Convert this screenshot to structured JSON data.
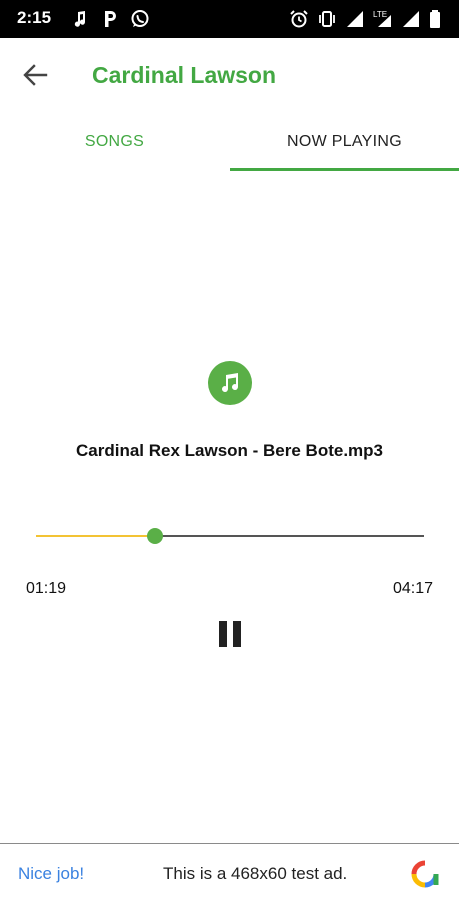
{
  "status_bar": {
    "time": "2:15",
    "left_icons": [
      "music-note-icon",
      "p-icon",
      "whatsapp-icon"
    ],
    "right_icons": [
      "alarm-icon",
      "vibrate-icon",
      "signal-icon",
      "lte-icon",
      "signal-icon",
      "battery-icon"
    ],
    "network": "LTE"
  },
  "app_bar": {
    "title": "Cardinal Lawson",
    "accent_color": "#43a843"
  },
  "tabs": [
    {
      "label": "SONGS",
      "selected": false
    },
    {
      "label": "NOW PLAYING",
      "selected": true
    }
  ],
  "player": {
    "track_title": "Cardinal Rex Lawson - Bere Bote.mp3",
    "elapsed": "01:19",
    "total": "04:17",
    "progress": 0.307,
    "state": "playing",
    "seek_fill_color": "#f3c334",
    "thumb_color": "#5aaf47"
  },
  "ad": {
    "link_text": "Nice job!",
    "text": "This is a 468x60 test ad."
  }
}
